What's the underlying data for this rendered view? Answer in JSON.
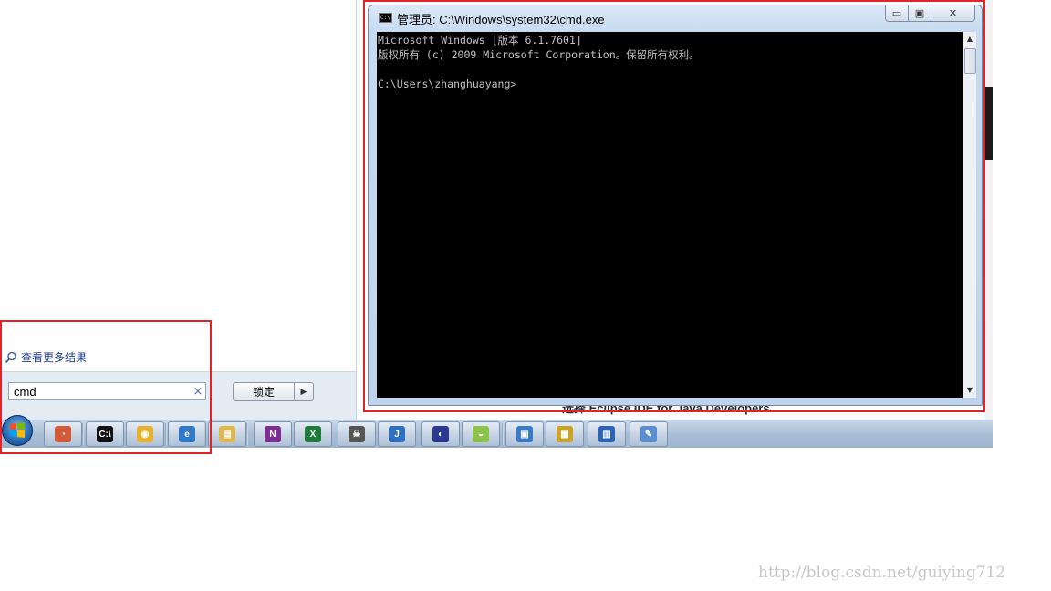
{
  "start_menu": {
    "more_results": "查看更多结果",
    "search_value": "cmd",
    "clear_symbol": "×",
    "lock_label": "锁定",
    "lock_arrow": "▶"
  },
  "background_page": {
    "caption": "选择 Eclipse IDE for Java Developers ."
  },
  "cmd_window": {
    "title": "管理员: C:\\Windows\\system32\\cmd.exe",
    "minimize": "▭",
    "maximize": "▣",
    "close": "✕",
    "lines": [
      "Microsoft Windows [版本 6.1.7601]",
      "版权所有 (c) 2009 Microsoft Corporation。保留所有权利。",
      "",
      "C:\\Users\\zhanghuayang>"
    ]
  },
  "taskbar": {
    "items": [
      {
        "name": "app-task",
        "color": "#d45a3a",
        "glyph": "◔"
      },
      {
        "name": "cmd",
        "color": "#111111",
        "glyph": "C:\\"
      },
      {
        "name": "chrome",
        "color": "#e8b32a",
        "glyph": "◉"
      },
      {
        "name": "internet-explorer",
        "color": "#2f79c9",
        "glyph": "e"
      },
      {
        "name": "file-explorer",
        "color": "#e0b84a",
        "glyph": "▤"
      },
      {
        "name": "onenote",
        "color": "#7a2e8f",
        "glyph": "N"
      },
      {
        "name": "excel",
        "color": "#1e7b3a",
        "glyph": "X"
      },
      {
        "name": "alien-app",
        "color": "#555555",
        "glyph": "☠"
      },
      {
        "name": "java-ide",
        "color": "#2e6fbf",
        "glyph": "J"
      },
      {
        "name": "eclipse",
        "color": "#2b3a8f",
        "glyph": "◐"
      },
      {
        "name": "android",
        "color": "#8bc34a",
        "glyph": "◒"
      },
      {
        "name": "remote-desktop",
        "color": "#3a7bc8",
        "glyph": "▣"
      },
      {
        "name": "notes",
        "color": "#c9a227",
        "glyph": "▦"
      },
      {
        "name": "network-monitor",
        "color": "#2a63b8",
        "glyph": "▥"
      },
      {
        "name": "paint",
        "color": "#5a8ed0",
        "glyph": "✎"
      }
    ]
  },
  "watermark": "http://blog.csdn.net/guiying712"
}
